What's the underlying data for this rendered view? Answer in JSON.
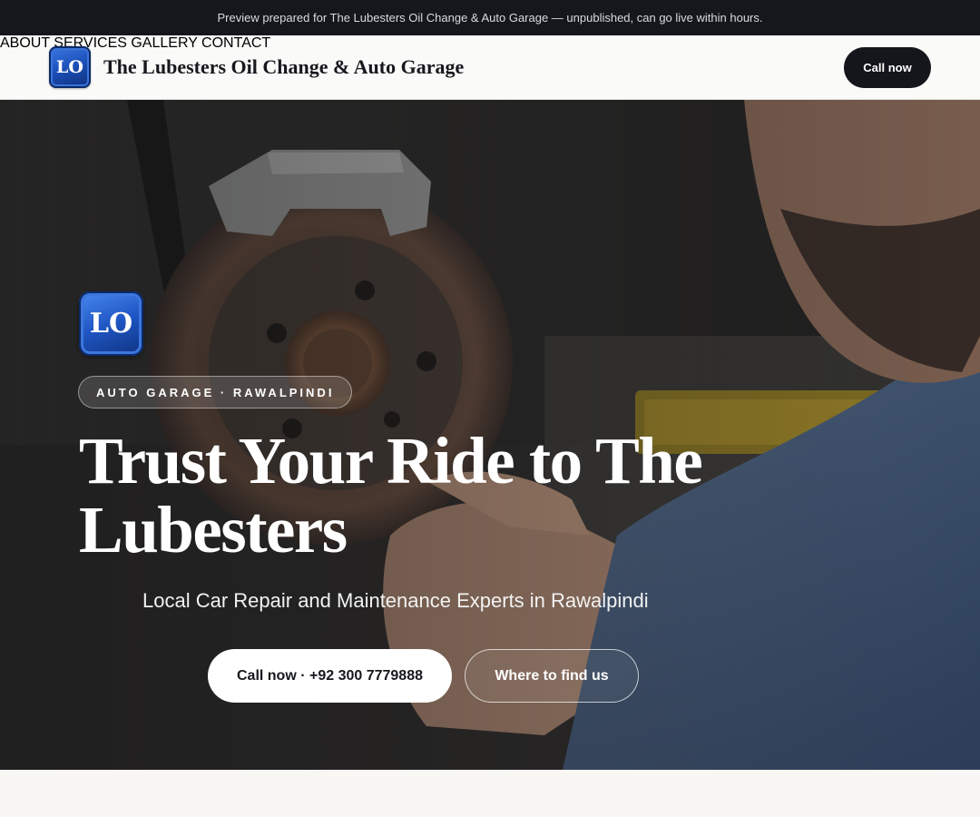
{
  "banner": {
    "text": "Preview prepared for The Lubesters Oil Change & Auto Garage — unpublished, can go live within hours."
  },
  "header": {
    "logo_initials": "LO",
    "brand_name": "The Lubesters Oil Change & Auto Garage",
    "nav": [
      {
        "label": "ABOUT"
      },
      {
        "label": "SERVICES"
      },
      {
        "label": "GALLERY"
      },
      {
        "label": "CONTACT"
      }
    ],
    "cta_label": "Call now"
  },
  "hero": {
    "logo_initials": "LO",
    "tag": "AUTO GARAGE · RAWALPINDI",
    "headline": "Trust Your Ride to The Lubesters",
    "subheadline": "Local Car Repair and Maintenance Experts in Rawalpindi",
    "primary_button": "Call now · +92 300 7779888",
    "secondary_button": "Where to find us"
  },
  "colors": {
    "banner_bg": "#15171c",
    "header_bg": "#fafaf8",
    "dark_button": "#14161b",
    "logo_blue": "#1b4fb8",
    "page_bg": "#f8f7f4"
  }
}
